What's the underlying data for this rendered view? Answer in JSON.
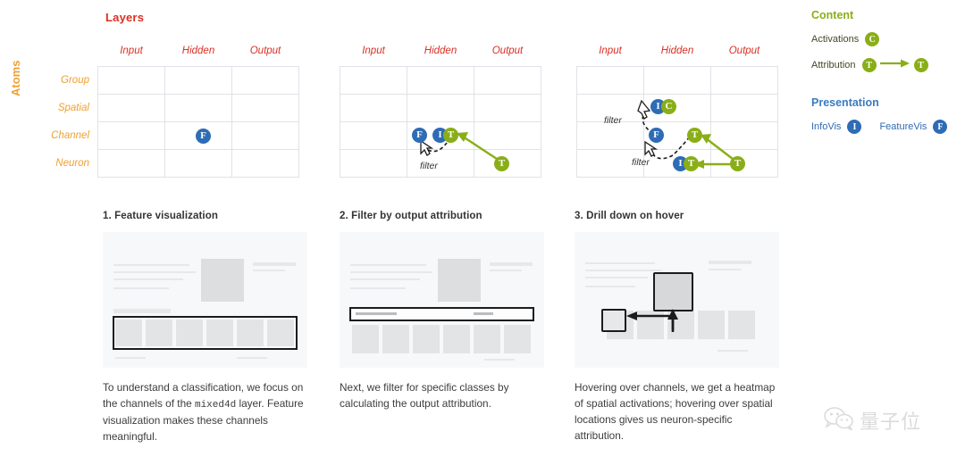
{
  "matrix": {
    "col_axis_label": "Layers",
    "row_axis_label": "Atoms",
    "columns": [
      "Input",
      "Hidden",
      "Output"
    ],
    "rows": [
      "Group",
      "Spatial",
      "Channel",
      "Neuron"
    ],
    "filter_label": "filter",
    "panels": [
      {
        "id": "panel-1",
        "badges": [
          {
            "letter": "F",
            "color": "blue",
            "row": "Channel",
            "col": "Hidden"
          }
        ]
      },
      {
        "id": "panel-2",
        "badges": [
          {
            "letter": "F",
            "color": "blue",
            "row": "Channel",
            "col": "Hidden"
          },
          {
            "letter": "I",
            "color": "blue",
            "row": "Channel",
            "col": "Hidden"
          },
          {
            "letter": "T",
            "color": "green",
            "row": "Channel",
            "col": "Hidden"
          },
          {
            "letter": "T",
            "color": "green",
            "row": "Neuron",
            "col": "Output"
          }
        ],
        "filter_labels": [
          "filter"
        ]
      },
      {
        "id": "panel-3",
        "badges": [
          {
            "letter": "I",
            "color": "blue",
            "row": "Spatial",
            "col": "Hidden"
          },
          {
            "letter": "C",
            "color": "green",
            "row": "Spatial",
            "col": "Hidden"
          },
          {
            "letter": "F",
            "color": "blue",
            "row": "Channel",
            "col": "Hidden"
          },
          {
            "letter": "T",
            "color": "green",
            "row": "Channel",
            "col": "Hidden"
          },
          {
            "letter": "I",
            "color": "blue",
            "row": "Neuron",
            "col": "Hidden"
          },
          {
            "letter": "T",
            "color": "green",
            "row": "Neuron",
            "col": "Hidden"
          },
          {
            "letter": "T",
            "color": "green",
            "row": "Neuron",
            "col": "Output"
          }
        ],
        "filter_labels": [
          "filter",
          "filter"
        ]
      }
    ]
  },
  "legend": {
    "content": {
      "heading": "Content",
      "items": [
        {
          "label": "Activations",
          "badge": "C",
          "color": "green"
        },
        {
          "label": "Attribution",
          "badge_from": "T",
          "badge_to": "T",
          "color": "green"
        }
      ]
    },
    "presentation": {
      "heading": "Presentation",
      "items": [
        {
          "label": "InfoVis",
          "badge": "I",
          "color": "blue"
        },
        {
          "label": "FeatureVis",
          "badge": "F",
          "color": "blue"
        }
      ]
    }
  },
  "steps": [
    {
      "title": "1. Feature visualization",
      "text_parts": [
        "To understand a classification, we focus on the channels of the ",
        "mixed4d",
        " layer. Feature visualization makes these channels meaningful."
      ]
    },
    {
      "title": "2. Filter by output attribution",
      "text": "Next, we filter for specific classes by calculating the output attribution."
    },
    {
      "title": "3. Drill down on hover",
      "text": "Hovering over channels, we get a heatmap of spatial activations; hovering over spatial locations gives us neuron-specific attribution."
    }
  ],
  "watermark": {
    "text": "量子位",
    "icon": "wechat-icon"
  },
  "colors": {
    "layers_red": "#d93025",
    "atoms_orange": "#f0a030",
    "content_green": "#8aae17",
    "presentation_blue": "#3a7bbf",
    "badge_blue": "#2e6cb5",
    "badge_green": "#8aae17"
  }
}
